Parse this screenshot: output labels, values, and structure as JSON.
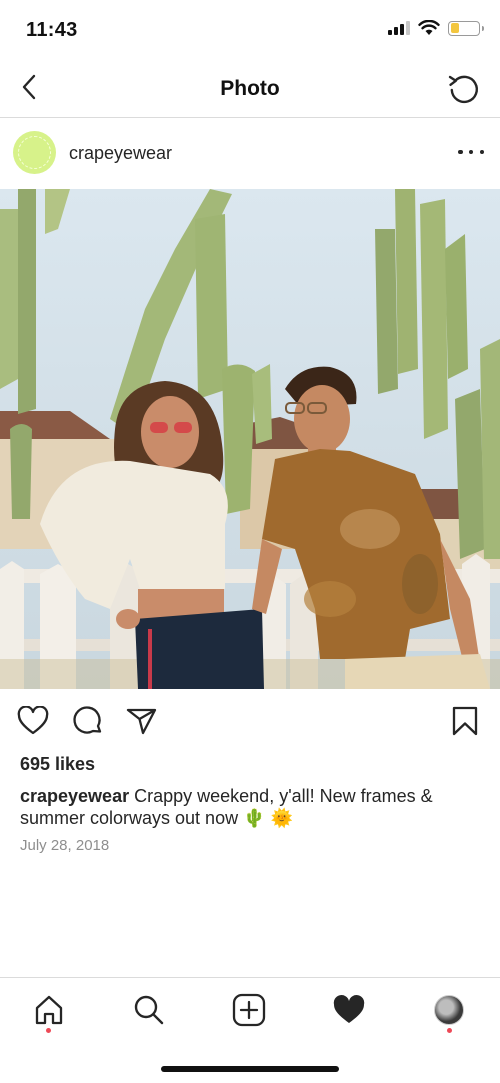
{
  "status_bar": {
    "time": "11:43",
    "icons": [
      "cellular-signal-icon",
      "wifi-icon",
      "battery-icon"
    ],
    "battery_level": 0.3,
    "battery_color": "#f3c63f"
  },
  "header": {
    "title": "Photo",
    "back_icon": "chevron-left-icon",
    "refresh_icon": "refresh-icon"
  },
  "post": {
    "username": "crapeyewear",
    "avatar_color": "#d7f28a",
    "more_icon": "more-horizontal-icon",
    "likes": "695 likes",
    "caption_user": "crapeyewear",
    "caption_text": "Crappy weekend, y'all! New frames & summer colorways out now 🌵 🌞",
    "date": "July 28, 2018"
  },
  "actions": {
    "like_icon": "heart-outline-icon",
    "comment_icon": "comment-icon",
    "share_icon": "paper-plane-icon",
    "save_icon": "bookmark-icon"
  },
  "tab_bar": {
    "tabs": [
      "home-icon",
      "search-icon",
      "add-icon",
      "heart-filled-icon",
      "profile-avatar"
    ],
    "notification_color": "#ed4956"
  }
}
